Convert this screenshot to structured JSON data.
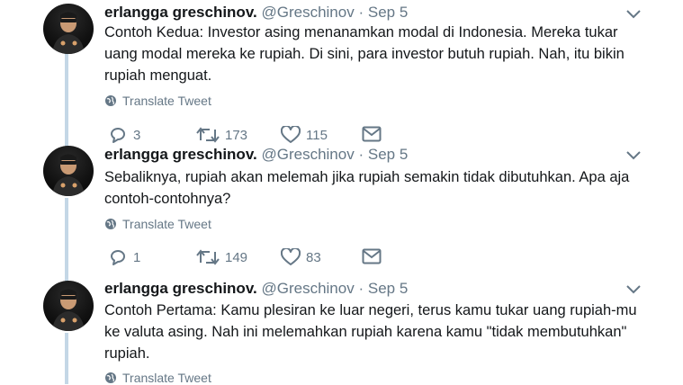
{
  "tweets": [
    {
      "name": "erlangga greschinov.",
      "handle": "@Greschinov",
      "separator": "·",
      "date": "Sep 5",
      "text_lines": [
        "Contoh Kedua: Investor asing menanamkan modal di Indonesia. Mereka tukar",
        "uang modal mereka ke rupiah. Di sini, para investor butuh rupiah. Nah, itu bikin",
        "rupiah menguat."
      ],
      "translate_label": "Translate Tweet",
      "replies": "3",
      "retweets": "173",
      "likes": "115"
    },
    {
      "name": "erlangga greschinov.",
      "handle": "@Greschinov",
      "separator": "·",
      "date": "Sep 5",
      "text_lines": [
        "Sebaliknya, rupiah akan melemah jika rupiah semakin tidak dibutuhkan. Apa aja",
        "contoh-contohnya?"
      ],
      "translate_label": "Translate Tweet",
      "replies": "1",
      "retweets": "149",
      "likes": "83"
    },
    {
      "name": "erlangga greschinov.",
      "handle": "@Greschinov",
      "separator": "·",
      "date": "Sep 5",
      "text_lines": [
        "Contoh Pertama: Kamu plesiran ke luar negeri, terus kamu tukar uang rupiah-mu",
        "ke valuta asing. Nah ini melemahkan rupiah karena kamu \"tidak membutuhkan\"",
        "rupiah."
      ],
      "translate_label": "Translate Tweet"
    }
  ],
  "colors": {
    "text": "#14171a",
    "secondary": "#657786",
    "thread_line": "#c4d7e6",
    "retweet": "#657786"
  },
  "icons": [
    "chevron-down-icon",
    "globe-icon",
    "reply-icon",
    "retweet-icon",
    "like-icon",
    "dm-icon"
  ]
}
